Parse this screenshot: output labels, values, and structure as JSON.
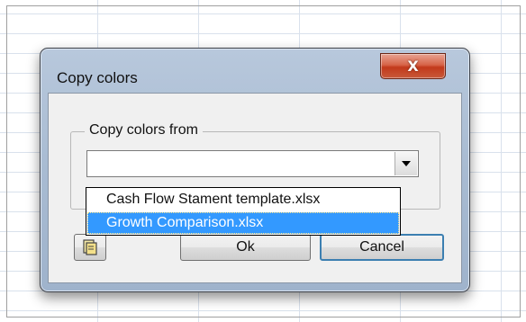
{
  "dialog": {
    "title": "Copy colors",
    "close_label": "X",
    "group_label": "Copy colors from",
    "combo_value": "",
    "ok_label": "Ok",
    "cancel_label": "Cancel"
  },
  "dropdown": {
    "items": [
      {
        "label": "Cash Flow Stament template.xlsx",
        "selected": false
      },
      {
        "label": "Growth Comparison.xlsx",
        "selected": true
      }
    ]
  },
  "colors": {
    "selection": "#3399ff",
    "close_button": "#c8452a",
    "dialog_frame": "#a8bbd2"
  },
  "icons": [
    "close-icon",
    "chevron-down-icon",
    "document-icon"
  ]
}
